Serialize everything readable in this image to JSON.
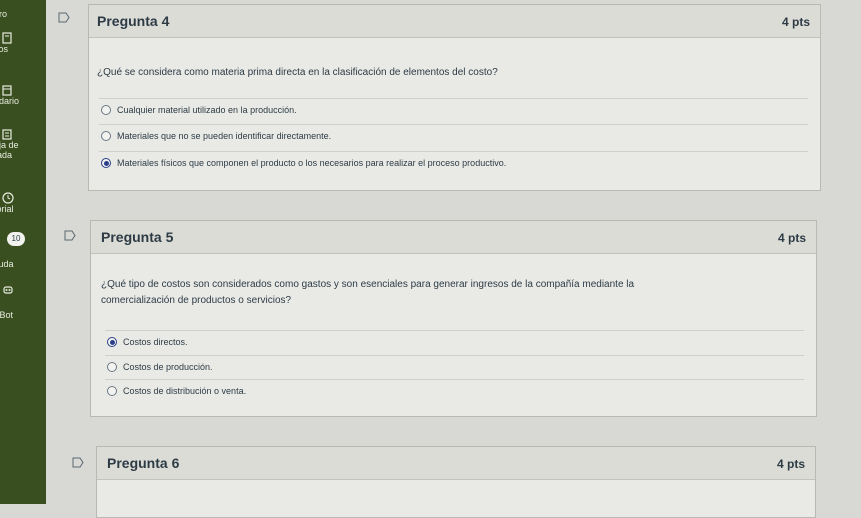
{
  "nav": {
    "items": [
      {
        "label": "ero"
      },
      {
        "label": "sos"
      },
      {
        "label": "ndario"
      },
      {
        "label": "eja de"
      },
      {
        "label": "rada"
      },
      {
        "label": "torial"
      },
      {
        "label": "yuda"
      },
      {
        "label": "TBot"
      }
    ],
    "badge": "10"
  },
  "questions": [
    {
      "title": "Pregunta 4",
      "points": "4 pts",
      "text": "¿Qué se considera como materia prima directa en la clasificación de elementos del costo?",
      "answers": [
        {
          "label": "Cualquier material utilizado en la producción.",
          "selected": false
        },
        {
          "label": "Materiales que no se pueden identificar directamente.",
          "selected": false
        },
        {
          "label": "Materiales físicos que componen el producto o los necesarios para realizar el proceso productivo.",
          "selected": true
        }
      ]
    },
    {
      "title": "Pregunta 5",
      "points": "4 pts",
      "text_line1": "¿Qué tipo de costos son considerados como gastos y son esenciales para generar ingresos de la compañía mediante la",
      "text_line2": "comercialización de productos o servicios?",
      "answers": [
        {
          "label": "Costos directos.",
          "selected": true
        },
        {
          "label": "Costos de producción.",
          "selected": false
        },
        {
          "label": "Costos de distribución o venta.",
          "selected": false
        }
      ]
    },
    {
      "title": "Pregunta 6",
      "points": "4 pts"
    }
  ],
  "colors": {
    "nav_bg": "#3a4f20",
    "selected_radio": "#2b3f8a"
  }
}
